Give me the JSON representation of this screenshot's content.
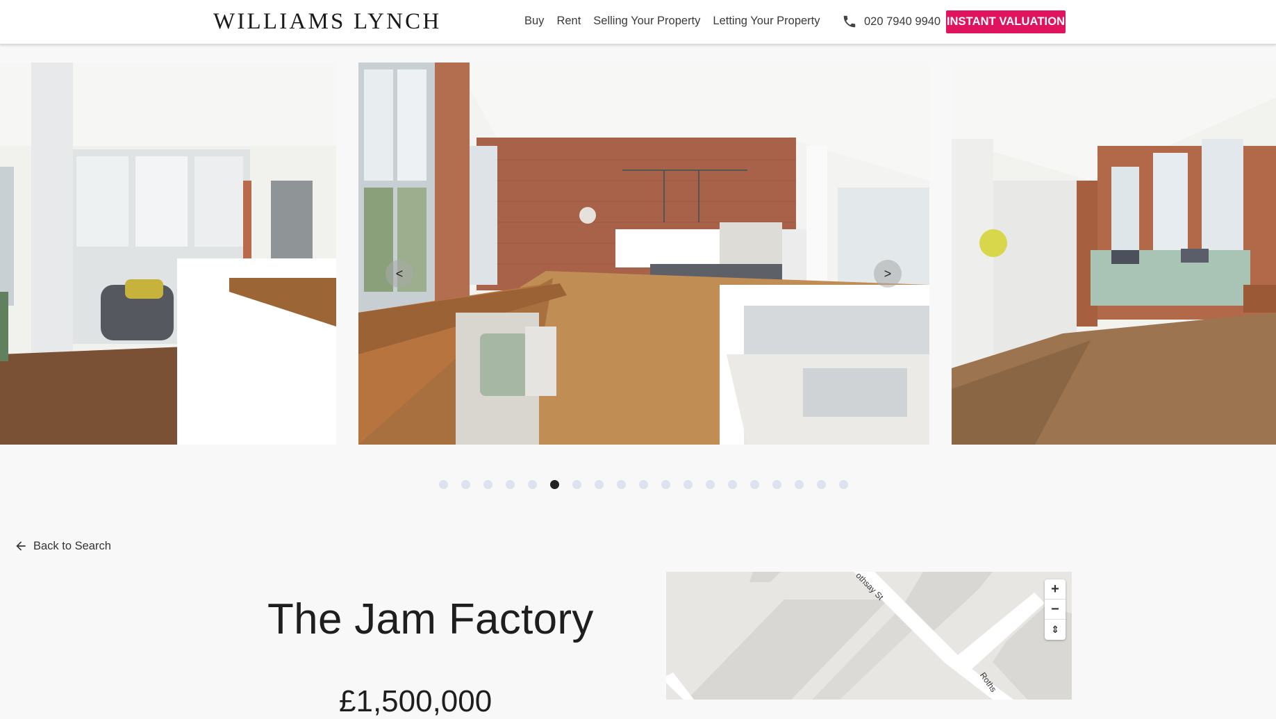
{
  "header": {
    "logo": "WILLIAMS LYNCH",
    "nav": [
      "Buy",
      "Rent",
      "Selling Your Property",
      "Letting Your Property"
    ],
    "phone": "020 7940 9940",
    "cta": "INSTANT VALUATION",
    "cta_color": "#e0135e"
  },
  "carousel": {
    "prev_label": "<",
    "next_label": ">",
    "dot_count": 19,
    "active_index": 5
  },
  "back_link": "Back to Search",
  "property": {
    "title": "The Jam Factory",
    "price": "£1,500,000"
  },
  "map": {
    "zoom_in": "+",
    "zoom_out": "−",
    "reset": "⇕",
    "street_1": "othsay St",
    "street_2": "Roths"
  }
}
